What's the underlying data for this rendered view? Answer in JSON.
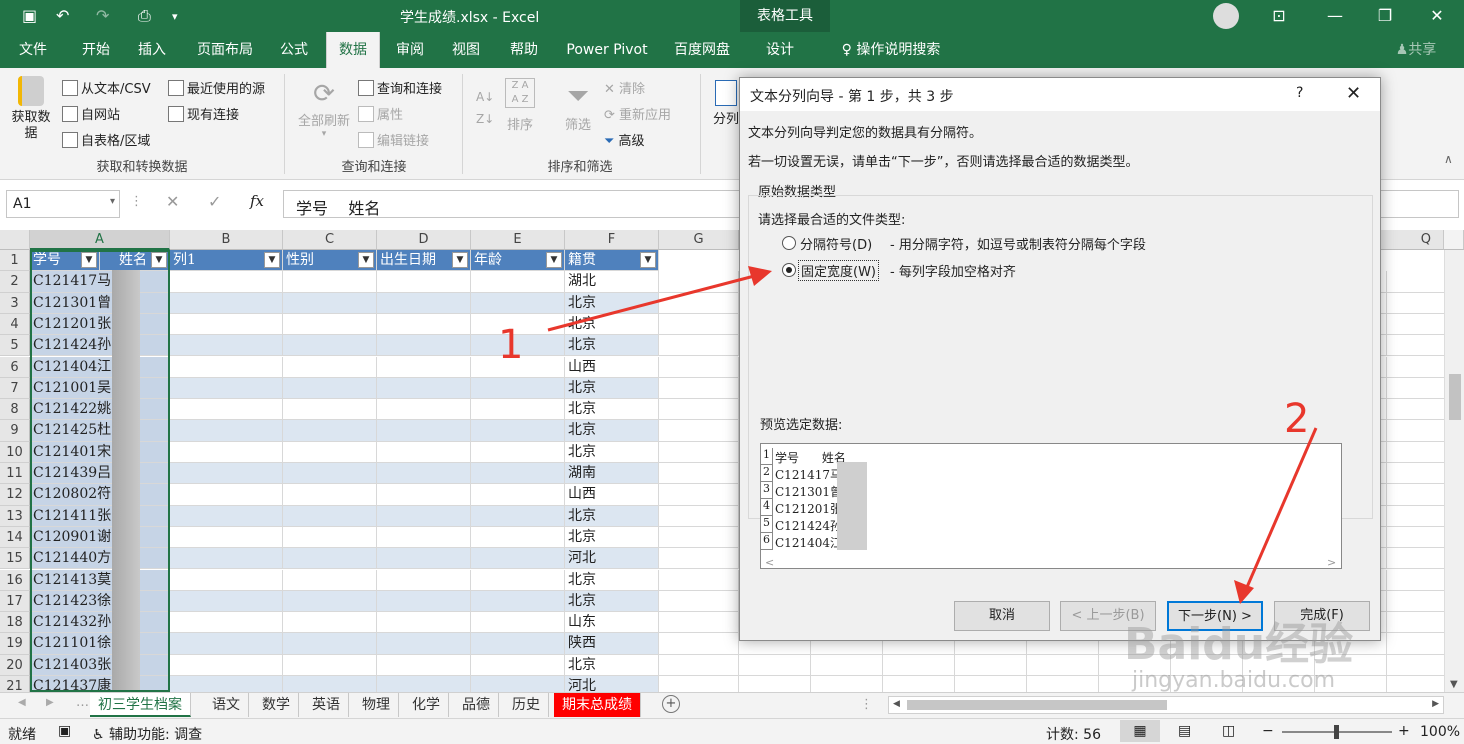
{
  "window": {
    "title": "学生成绩.xlsx  -  Excel",
    "tools_label": "表格工具",
    "share": "共享"
  },
  "ribbon_tabs": [
    "文件",
    "开始",
    "插入",
    "页面布局",
    "公式",
    "数据",
    "审阅",
    "视图",
    "帮助",
    "Power Pivot",
    "百度网盘",
    "设计"
  ],
  "tell_me": "操作说明搜索",
  "ribbon": {
    "get_data": "获取数\n据",
    "from_text": "从文本/CSV",
    "from_web": "自网站",
    "from_table": "自表格/区域",
    "recent_sources": "最近使用的源",
    "existing_conn": "现有连接",
    "group1": "获取和转换数据",
    "refresh_all": "全部刷新",
    "queries_conn": "查询和连接",
    "properties": "属性",
    "edit_links": "编辑链接",
    "group2": "查询和连接",
    "sort": "排序",
    "filter": "筛选",
    "clear": "清除",
    "reapply": "重新应用",
    "advanced": "高级",
    "group3": "排序和筛选",
    "split": "分列"
  },
  "formula_bar": {
    "name_box": "A1",
    "fx": "fx",
    "content": "学号    姓名"
  },
  "columns": [
    "A",
    "B",
    "C",
    "D",
    "E",
    "F",
    "G",
    "Q"
  ],
  "header_row": [
    "学号",
    "姓名",
    "列1",
    "性别",
    "出生日期",
    "年龄",
    "籍贯"
  ],
  "rows": [
    {
      "n": "2",
      "id": "C121417马",
      "place": "湖北"
    },
    {
      "n": "3",
      "id": "C121301曾",
      "place": "北京"
    },
    {
      "n": "4",
      "id": "C121201张",
      "place": "北京"
    },
    {
      "n": "5",
      "id": "C121424孙",
      "place": "北京"
    },
    {
      "n": "6",
      "id": "C121404江",
      "place": "山西"
    },
    {
      "n": "7",
      "id": "C121001吴",
      "place": "北京"
    },
    {
      "n": "8",
      "id": "C121422姚",
      "place": "北京"
    },
    {
      "n": "9",
      "id": "C121425杜",
      "place": "北京"
    },
    {
      "n": "10",
      "id": "C121401宋",
      "place": "北京"
    },
    {
      "n": "11",
      "id": "C121439吕",
      "place": "湖南"
    },
    {
      "n": "12",
      "id": "C120802符",
      "place": "山西"
    },
    {
      "n": "13",
      "id": "C121411张",
      "place": "北京"
    },
    {
      "n": "14",
      "id": "C120901谢",
      "place": "北京"
    },
    {
      "n": "15",
      "id": "C121440方",
      "place": "河北"
    },
    {
      "n": "16",
      "id": "C121413莫",
      "place": "北京"
    },
    {
      "n": "17",
      "id": "C121423徐",
      "place": "北京"
    },
    {
      "n": "18",
      "id": "C121432孙",
      "place": "山东"
    },
    {
      "n": "19",
      "id": "C121101徐",
      "place": "陕西"
    },
    {
      "n": "20",
      "id": "C121403张",
      "place": "北京"
    },
    {
      "n": "21",
      "id": "C121437康",
      "place": "河北"
    }
  ],
  "sheet_tabs": [
    "初三学生档案",
    "语文",
    "数学",
    "英语",
    "物理",
    "化学",
    "品德",
    "历史",
    "期末总成绩"
  ],
  "status": {
    "ready": "就绪",
    "accessibility": "辅助功能: 调查",
    "count": "计数: 56",
    "zoom": "100%"
  },
  "dialog": {
    "title": "文本分列向导 - 第 1 步，共 3 步",
    "help": "?",
    "line1": "文本分列向导判定您的数据具有分隔符。",
    "line2": "若一切设置无误，请单击“下一步”，否则请选择最合适的数据类型。",
    "group_label": "原始数据类型",
    "choose_label": "请选择最合适的文件类型:",
    "opt1": "分隔符号(D)",
    "opt1_desc": "- 用分隔字符，如逗号或制表符分隔每个字段",
    "opt2": "固定宽度(W)",
    "opt2_desc": "- 每列字段加空格对齐",
    "preview_label": "预览选定数据:",
    "preview_rows": [
      {
        "n": "1",
        "t": "学号      姓名"
      },
      {
        "n": "2",
        "t": "C121417马"
      },
      {
        "n": "3",
        "t": "C121301曾"
      },
      {
        "n": "4",
        "t": "C121201张"
      },
      {
        "n": "5",
        "t": "C121424孙"
      },
      {
        "n": "6",
        "t": "C121404江"
      }
    ],
    "btn_cancel": "取消",
    "btn_back": "< 上一步(B)",
    "btn_next": "下一步(N) >",
    "btn_finish": "完成(F)"
  },
  "annotations": {
    "a1": "1",
    "a2": "2"
  },
  "watermark": "Baidu经验",
  "watermark_url": "jingyan.baidu.com",
  "colors": {
    "excel_green": "#217346",
    "table_header": "#4f81bd",
    "band": "#dce6f1",
    "arrow": "#e8372c"
  }
}
